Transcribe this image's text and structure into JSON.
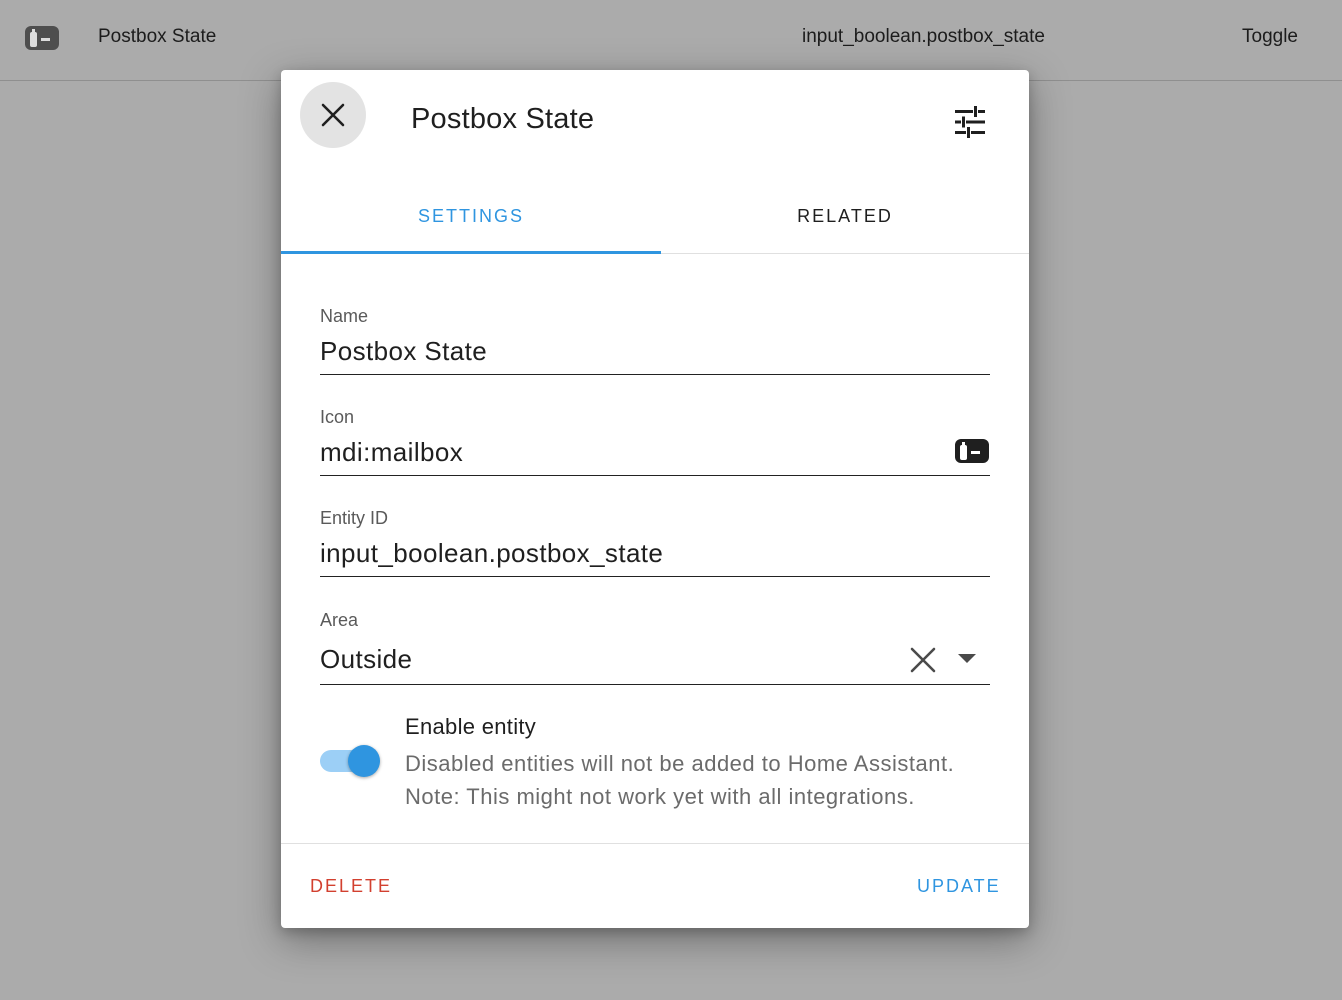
{
  "background_row": {
    "name": "Postbox State",
    "entity_id": "input_boolean.postbox_state",
    "type": "Toggle",
    "icon": "mailbox-icon"
  },
  "dialog": {
    "title": "Postbox State",
    "close_icon": "close-icon",
    "settings_icon": "tune-icon",
    "tabs": [
      {
        "label": "SETTINGS",
        "active": true
      },
      {
        "label": "RELATED",
        "active": false
      }
    ],
    "fields": {
      "name": {
        "label": "Name",
        "value": "Postbox State"
      },
      "icon": {
        "label": "Icon",
        "value": "mdi:mailbox",
        "trailing_icon": "mailbox-icon"
      },
      "entity_id": {
        "label": "Entity ID",
        "value": "input_boolean.postbox_state"
      },
      "area": {
        "label": "Area",
        "value": "Outside",
        "clear_icon": "close-icon",
        "dropdown_icon": "menu-down-icon"
      }
    },
    "enable_entity": {
      "title": "Enable entity",
      "description": "Disabled entities will not be added to Home Assistant. Note: This might not work yet with all integrations.",
      "enabled": true
    },
    "actions": {
      "delete": "DELETE",
      "update": "UPDATE"
    }
  },
  "colors": {
    "accent": "#2f95e0",
    "danger": "#d2402f",
    "scrim": "#ababab"
  }
}
